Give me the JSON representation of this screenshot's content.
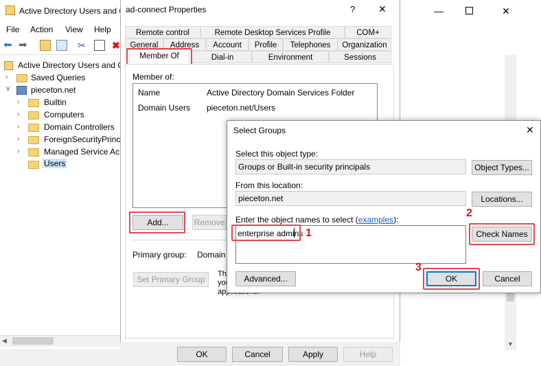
{
  "mmc": {
    "title": "Active Directory Users and C",
    "menu": [
      "File",
      "Action",
      "View",
      "Help"
    ],
    "tree": {
      "root": "Active Directory Users and C",
      "saved_queries": "Saved Queries",
      "domain": "pieceton.net",
      "children": [
        "Builtin",
        "Computers",
        "Domain Controllers",
        "ForeignSecurityPrinc",
        "Managed Service Ac",
        "Users"
      ]
    }
  },
  "props": {
    "title": "ad-connect Properties",
    "help_glyph": "?",
    "close_glyph": "✕",
    "tabs_row1": [
      "Remote control",
      "Remote Desktop Services Profile",
      "COM+"
    ],
    "tabs_row2": [
      "General",
      "Address",
      "Account",
      "Profile",
      "Telephones",
      "Organization"
    ],
    "tabs_row3": [
      "Member Of",
      "Dial-in",
      "Environment",
      "Sessions"
    ],
    "member_of_label": "Member of:",
    "columns": [
      "Name",
      "Active Directory Domain Services Folder"
    ],
    "rows": [
      {
        "name": "Domain Users",
        "folder": "pieceton.net/Users"
      }
    ],
    "add_button": "Add...",
    "remove_button": "Remove",
    "primary_group_label": "Primary group:",
    "primary_group_value": "Domain U",
    "set_primary_button": "Set Primary Group",
    "note_line1": "The",
    "note_line2": "you",
    "note_line3": "applications.",
    "footer": {
      "ok": "OK",
      "cancel": "Cancel",
      "apply": "Apply",
      "help": "Help"
    }
  },
  "select_groups": {
    "title": "Select Groups",
    "close_glyph": "✕",
    "object_type_label": "Select this object type:",
    "object_type_value": "Groups or Built-in security principals",
    "object_types_button": "Object Types...",
    "location_label": "From this location:",
    "location_value": "pieceton.net",
    "locations_button": "Locations...",
    "names_label_prefix": "Enter the object names to select (",
    "names_label_link": "examples",
    "names_label_suffix": "):",
    "names_value": "enterprise admins",
    "check_names_button": "Check Names",
    "advanced_button": "Advanced...",
    "ok_button": "OK",
    "cancel_button": "Cancel"
  },
  "steps": [
    "1",
    "2",
    "3"
  ],
  "colors": {
    "highlight": "#e0474c",
    "step_number": "#e0101a",
    "link": "#0066cc",
    "folder": "#f5d37a"
  }
}
